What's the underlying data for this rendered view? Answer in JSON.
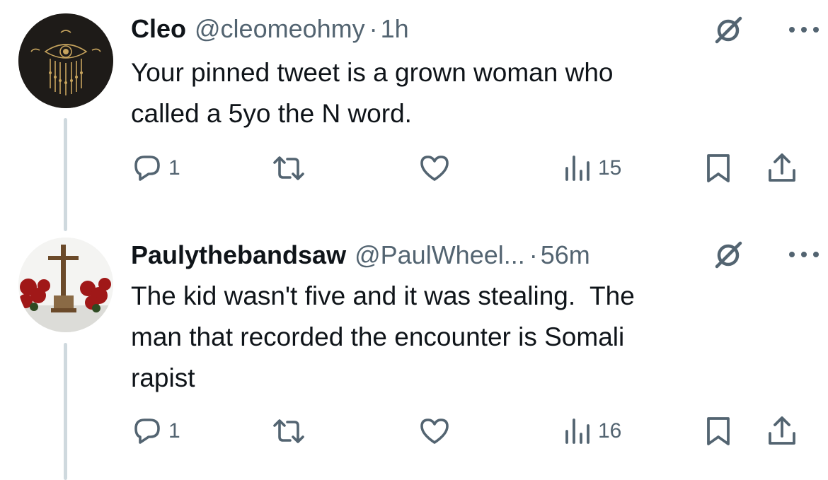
{
  "tweets": [
    {
      "name": "Cleo",
      "handle": "@cleomeohmy",
      "separator": "·",
      "time": "1h",
      "text": "Your pinned tweet is a grown woman who\ncalled a 5yo the N word.",
      "replies": "1",
      "views": "15",
      "avatar_icon": "eye-emblem-avatar"
    },
    {
      "name": "Paulythebandsaw",
      "handle": "@PaulWheel...",
      "separator": "·",
      "time": "56m",
      "text": "The kid wasn't five and it was stealing.  The\nman that recorded the encounter is Somali\nrapist",
      "replies": "1",
      "views": "16",
      "avatar_icon": "cross-poinsettia-avatar"
    }
  ],
  "icons": {
    "reply": "reply-icon",
    "retweet": "retweet-icon",
    "like": "heart-icon",
    "views": "views-icon",
    "bookmark": "bookmark-icon",
    "share": "share-icon",
    "grok": "grok-icon",
    "more": "more-icon"
  },
  "colors": {
    "text": "#0f1419",
    "secondary": "#536471",
    "thread_line": "#cfd9de",
    "icon": "#536471"
  }
}
